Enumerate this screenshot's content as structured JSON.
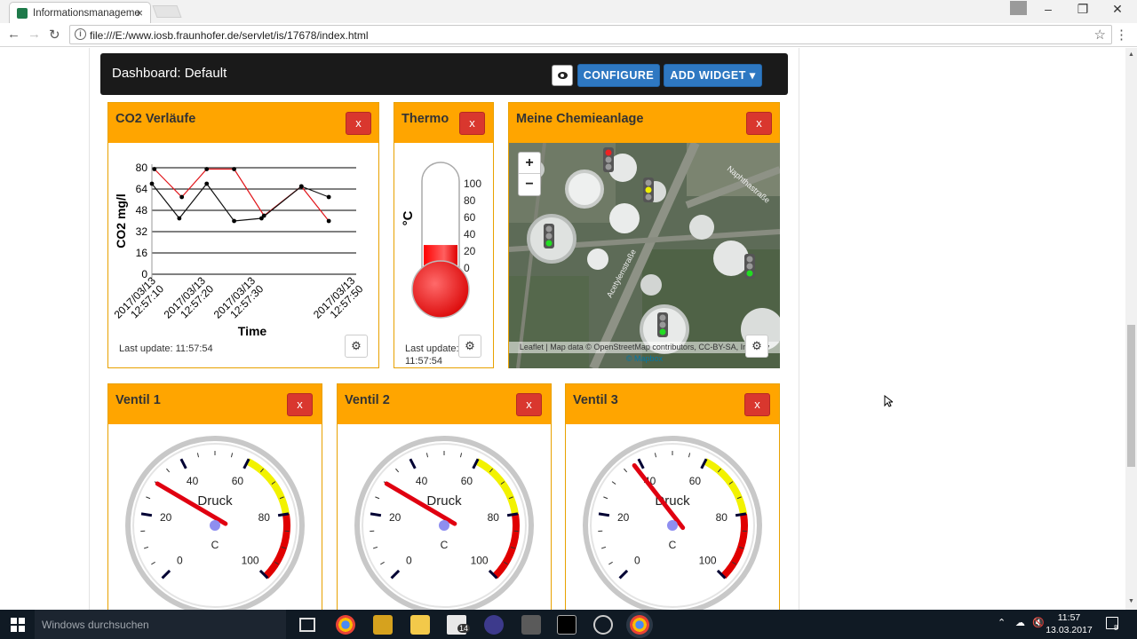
{
  "browser": {
    "tab_title": "Informationsmanageme",
    "tab_close": "×",
    "url": "file:///E:/www.iosb.fraunhofer.de/servlet/is/17678/index.html",
    "window_controls": [
      "–",
      "❐",
      "✕"
    ]
  },
  "dashboard": {
    "title": "Dashboard: Default",
    "configure_label": "CONFIGURE",
    "add_widget_label": "ADD WIDGET ▾"
  },
  "widgets": {
    "co2": {
      "title": "CO2 Verläufe",
      "close_label": "x",
      "last_update": "Last update: 11:57:54"
    },
    "thermo": {
      "title": "Thermo",
      "close_label": "x",
      "unit": "°C",
      "scale": [
        "100",
        "80",
        "60",
        "40",
        "20",
        "0"
      ],
      "fill_fraction": 0.46,
      "last_update_line1": "Last update:",
      "last_update_line2": "11:57:54"
    },
    "map": {
      "title": "Meine Chemieanlage",
      "close_label": "x",
      "zoom_in": "+",
      "zoom_out": "−",
      "street_labels": [
        "Naphthastraße",
        "Acetylenstraße"
      ],
      "attribution_line1": "Leaflet | Map data © OpenStreetMap contributors, CC-BY-SA, Imagery",
      "attribution_line2": "© Mapbox"
    },
    "ventil1": {
      "title": "Ventil 1",
      "close_label": "x",
      "gauge_label": "Druck",
      "gauge_unit": "C",
      "value": 30
    },
    "ventil2": {
      "title": "Ventil 2",
      "close_label": "x",
      "gauge_label": "Druck",
      "gauge_unit": "C",
      "value": 30
    },
    "ventil3": {
      "title": "Ventil 3",
      "close_label": "x",
      "gauge_label": "Druck",
      "gauge_unit": "C",
      "value": 38
    },
    "gauge_ticks": [
      "0",
      "20",
      "40",
      "60",
      "80",
      "100"
    ]
  },
  "chart_data": {
    "type": "line",
    "title": "",
    "xlabel": "Time",
    "ylabel": "CO2 mg/l",
    "ylim": [
      0,
      80
    ],
    "yticks": [
      "80",
      "64",
      "48",
      "32",
      "16",
      "0"
    ],
    "xticks": [
      {
        "line1": "2017/03/13",
        "line2": "12:57:10",
        "t": 0
      },
      {
        "line1": "2017/03/13",
        "line2": "12:57:20",
        "t": 10
      },
      {
        "line1": "2017/03/13",
        "line2": "12:57:30",
        "t": 20
      },
      {
        "line1": "2017/03/13",
        "line2": "12:57:50",
        "t": 40
      }
    ],
    "xlim": [
      -0.5,
      40.5
    ],
    "series": [
      {
        "color": "#e0151a",
        "x": [
          0,
          5.5,
          10.5,
          16,
          22,
          29.5,
          35
        ],
        "y": [
          79,
          58,
          79,
          79,
          44,
          66,
          40
        ]
      },
      {
        "color": "#111111",
        "x": [
          -0.5,
          5,
          10.5,
          16,
          21.5,
          29.5,
          35
        ],
        "y": [
          68,
          42,
          68,
          40,
          42,
          66,
          58
        ]
      }
    ]
  },
  "taskbar": {
    "search_placeholder": "Windows durchsuchen",
    "badge": "14",
    "time": "11:57",
    "date": "13.03.2017",
    "notif_count": "8"
  }
}
